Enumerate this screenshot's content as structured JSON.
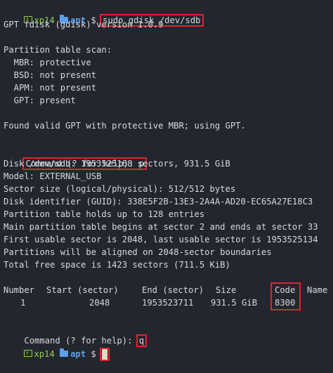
{
  "prompt": {
    "host": "xp14",
    "dir": "apt",
    "symbol": "$"
  },
  "command1": "sudo gdisk /dev/sdb",
  "version": "GPT fdisk (gdisk) version 1.0.9",
  "scan": {
    "heading": "Partition table scan:",
    "items": [
      "  MBR: protective",
      "  BSD: not present",
      "  APM: not present",
      "  GPT: present"
    ]
  },
  "found": "Found valid GPT with protective MBR; using GPT.",
  "cmd_prompt": "Command (? for help): ",
  "cmd_p": "p",
  "info": [
    "Disk /dev/sdb: 1953525168 sectors, 931.5 GiB",
    "Model: EXTERNAL_USB",
    "Sector size (logical/physical): 512/512 bytes",
    "Disk identifier (GUID): 338E5F2B-13E3-2A4A-AD20-EC65A27E18C3",
    "Partition table holds up to 128 entries",
    "Main partition table begins at sector 2 and ends at sector 33",
    "First usable sector is 2048, last usable sector is 1953525134",
    "Partitions will be aligned on 2048-sector boundaries",
    "Total free space is 1423 sectors (711.5 KiB)"
  ],
  "table": {
    "headers": {
      "number": "Number",
      "start": "Start (sector)",
      "end": "End (sector)",
      "size": "Size",
      "code": "Code",
      "name": "Name"
    },
    "rows": [
      {
        "number": "1",
        "start": "2048",
        "end": "1953523711",
        "size": "931.5 GiB",
        "code": "8300",
        "name": ""
      }
    ]
  },
  "cmd_q": "q",
  "colors": {
    "background": "#23262e",
    "text": "#d6d9de",
    "host": "#8fd14f",
    "dir": "#5aa0f0",
    "highlight": "#e0242c",
    "cursor": "#e9d7c9"
  }
}
